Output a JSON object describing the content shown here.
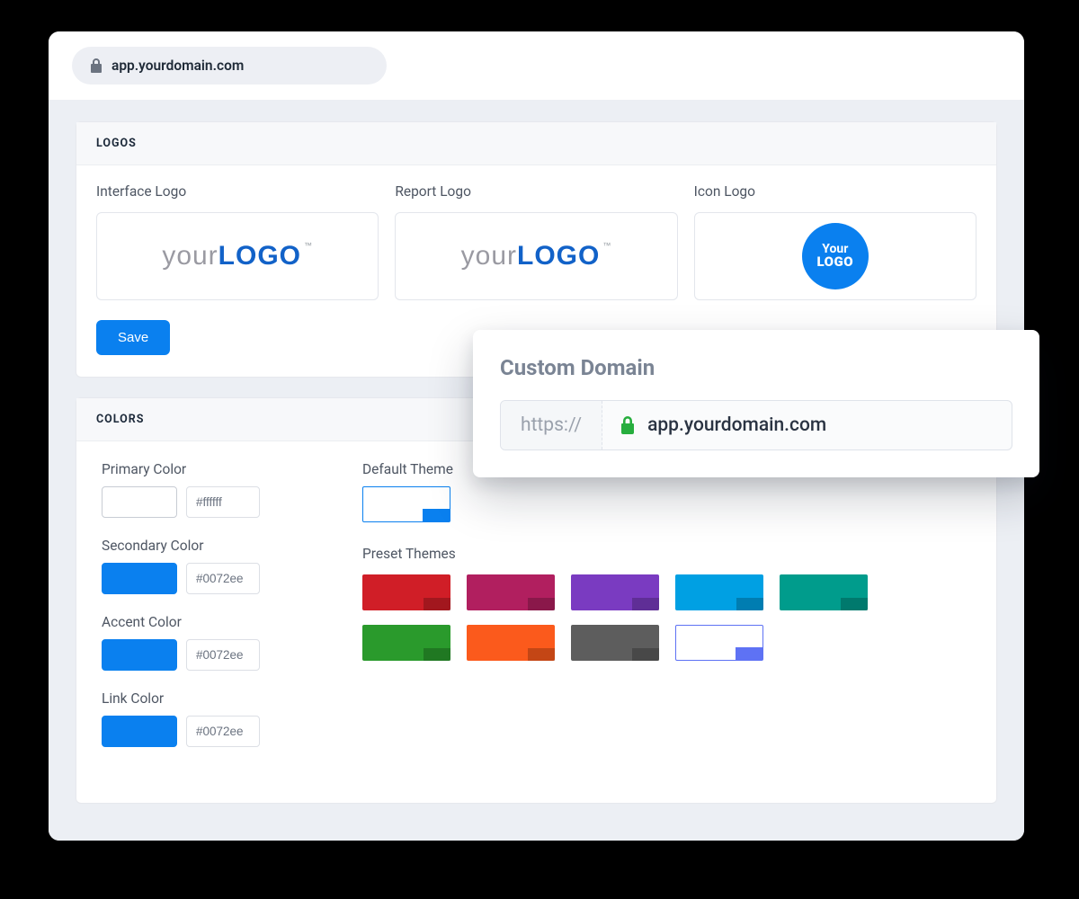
{
  "browser": {
    "url": "app.yourdomain.com"
  },
  "logos": {
    "section_title": "LOGOS",
    "interface_label": "Interface Logo",
    "report_label": "Report Logo",
    "icon_label": "Icon Logo",
    "logo_prefix": "your",
    "logo_bold": "LOGO",
    "logo_tm": "™",
    "icon_line1": "Your",
    "icon_line2": "LOGO",
    "save": "Save"
  },
  "colors": {
    "section_title": "COLORS",
    "primary": {
      "label": "Primary Color",
      "hex": "#ffffff",
      "swatch": "#ffffff"
    },
    "secondary": {
      "label": "Secondary Color",
      "hex": "#0072ee",
      "swatch": "#0a80ef"
    },
    "accent": {
      "label": "Accent Color",
      "hex": "#0072ee",
      "swatch": "#0a80ef"
    },
    "link": {
      "label": "Link Color",
      "hex": "#0072ee",
      "swatch": "#0a80ef"
    },
    "default_theme_label": "Default Theme",
    "preset_label": "Preset Themes",
    "default_theme": "#ffffff",
    "presets": [
      "#d01e27",
      "#b11f5f",
      "#7a3bc1",
      "#00a0e3",
      "#009c8c",
      "#2a9a2c",
      "#fb5a1c",
      "#5d5d5d",
      "#ffffff"
    ]
  },
  "popup": {
    "title": "Custom Domain",
    "protocol": "https://",
    "domain": "app.yourdomain.com"
  }
}
